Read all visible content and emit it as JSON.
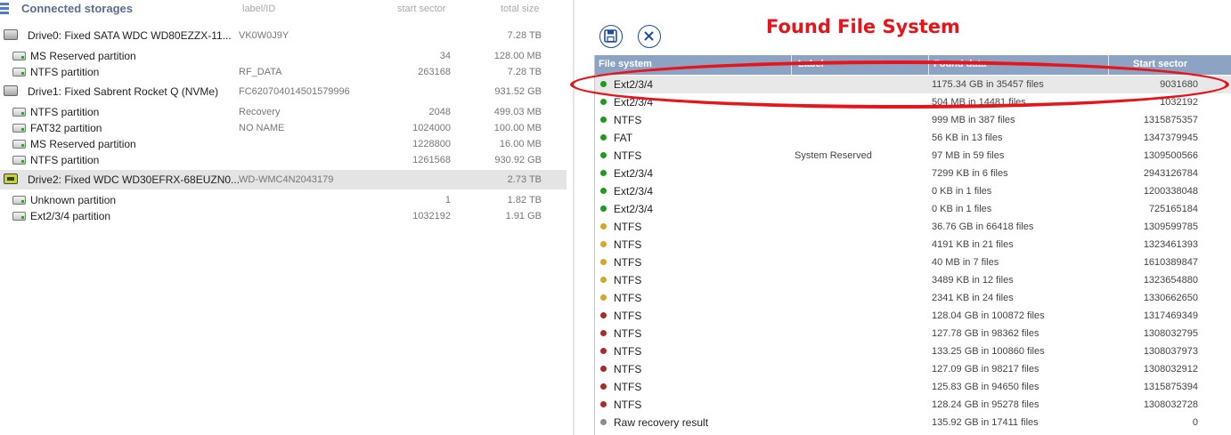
{
  "left": {
    "header": {
      "title": "Connected storages",
      "col_label": "label/ID",
      "col_start": "start sector",
      "col_size": "total size"
    },
    "rows": [
      {
        "kind": "drive",
        "name": "Drive0: Fixed SATA WDC WD80EZZX-11...",
        "label": "VK0W0J9Y",
        "start": "",
        "size": "7.28 TB"
      },
      {
        "kind": "part",
        "name": "MS Reserved partition",
        "label": "",
        "start": "34",
        "size": "128.00 MB"
      },
      {
        "kind": "part",
        "name": "NTFS partition",
        "label": "RF_DATA",
        "start": "263168",
        "size": "7.28 TB"
      },
      {
        "kind": "drive",
        "name": "Drive1: Fixed Sabrent Rocket Q (NVMe)",
        "label": "FC620704014501579996",
        "start": "",
        "size": "931.52 GB"
      },
      {
        "kind": "part",
        "name": "NTFS partition",
        "label": "Recovery",
        "start": "2048",
        "size": "499.03 MB"
      },
      {
        "kind": "part",
        "name": "FAT32 partition",
        "label": "NO NAME",
        "start": "1024000",
        "size": "100.00 MB"
      },
      {
        "kind": "part",
        "name": "MS Reserved partition",
        "label": "",
        "start": "1228800",
        "size": "16.00 MB"
      },
      {
        "kind": "part",
        "name": "NTFS partition",
        "label": "",
        "start": "1261568",
        "size": "930.92 GB"
      },
      {
        "kind": "drive",
        "name": "Drive2: Fixed WDC WD30EFRX-68EUZN0...",
        "label": "WD-WMC4N2043179",
        "start": "",
        "size": "2.73 TB",
        "selected": true,
        "icon": "green"
      },
      {
        "kind": "part",
        "name": "Unknown partition",
        "label": "",
        "start": "1",
        "size": "1.82 TB"
      },
      {
        "kind": "part",
        "name": "Ext2/3/4 partition",
        "label": "",
        "start": "1032192",
        "size": "1.91 GB"
      }
    ]
  },
  "right": {
    "title": "Found File System",
    "columns": {
      "fs": "File system",
      "label": "Label",
      "data": "Found data",
      "start": "Start sector"
    },
    "colors": {
      "green": "#1e9a1e",
      "yellow": "#d2a72c",
      "red": "#a72b2b",
      "gray": "#8c8c8c"
    },
    "rows": [
      {
        "status": "green",
        "fs": "Ext2/3/4",
        "label": "",
        "data": "1175.34 GB in 35457 files",
        "start": "9031680",
        "selected": true
      },
      {
        "status": "green",
        "fs": "Ext2/3/4",
        "label": "",
        "data": "504 MB in 14481 files",
        "start": "1032192"
      },
      {
        "status": "green",
        "fs": "NTFS",
        "label": "",
        "data": "999 MB in 387 files",
        "start": "1315875357"
      },
      {
        "status": "green",
        "fs": "FAT",
        "label": "",
        "data": "56 KB in 13 files",
        "start": "1347379945"
      },
      {
        "status": "green",
        "fs": "NTFS",
        "label": "System Reserved",
        "data": "97 MB in 59 files",
        "start": "1309500566"
      },
      {
        "status": "green",
        "fs": "Ext2/3/4",
        "label": "",
        "data": "7299 KB in 6 files",
        "start": "2943126784"
      },
      {
        "status": "green",
        "fs": "Ext2/3/4",
        "label": "",
        "data": "0 KB in 1 files",
        "start": "1200338048"
      },
      {
        "status": "green",
        "fs": "Ext2/3/4",
        "label": "",
        "data": "0 KB in 1 files",
        "start": "725165184"
      },
      {
        "status": "yellow",
        "fs": "NTFS",
        "label": "",
        "data": "36.76 GB in 66418 files",
        "start": "1309599785"
      },
      {
        "status": "yellow",
        "fs": "NTFS",
        "label": "",
        "data": "4191 KB in 21 files",
        "start": "1323461393"
      },
      {
        "status": "yellow",
        "fs": "NTFS",
        "label": "",
        "data": "40 MB in 7 files",
        "start": "1610389847"
      },
      {
        "status": "yellow",
        "fs": "NTFS",
        "label": "",
        "data": "3489 KB in 12 files",
        "start": "1323654880"
      },
      {
        "status": "yellow",
        "fs": "NTFS",
        "label": "",
        "data": "2341 KB in 24 files",
        "start": "1330662650"
      },
      {
        "status": "red",
        "fs": "NTFS",
        "label": "",
        "data": "128.04 GB in 100872 files",
        "start": "1317469349"
      },
      {
        "status": "red",
        "fs": "NTFS",
        "label": "",
        "data": "127.78 GB in 98362 files",
        "start": "1308032795"
      },
      {
        "status": "red",
        "fs": "NTFS",
        "label": "",
        "data": "133.25 GB in 100860 files",
        "start": "1308037973"
      },
      {
        "status": "red",
        "fs": "NTFS",
        "label": "",
        "data": "127.09 GB in 98217 files",
        "start": "1308032912"
      },
      {
        "status": "red",
        "fs": "NTFS",
        "label": "",
        "data": "125.83 GB in 94650 files",
        "start": "1315875394"
      },
      {
        "status": "red",
        "fs": "NTFS",
        "label": "",
        "data": "128.24 GB in 95278 files",
        "start": "1308032728"
      },
      {
        "status": "gray",
        "fs": "Raw recovery result",
        "label": "",
        "data": "135.92 GB in 17411 files",
        "start": "0"
      }
    ]
  }
}
